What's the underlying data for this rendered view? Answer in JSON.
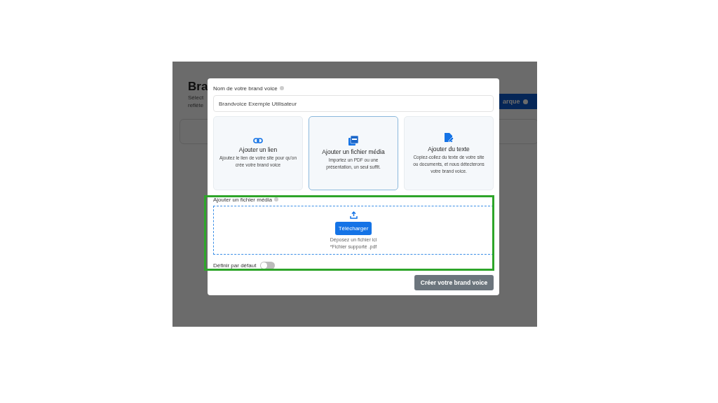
{
  "background_page": {
    "title": "Bra",
    "subtitle_lines": [
      "Sélect",
      "reflète"
    ],
    "button": "arque"
  },
  "modal": {
    "name_label": "Nom de votre brand voice",
    "name_value": "Brandvoice Exemple Utilisateur",
    "sources": [
      {
        "kind": "link",
        "title": "Ajouter un lien",
        "description": "Ajoutez le lien de votre site pour qu'on crée votre brand voice",
        "selected": false
      },
      {
        "kind": "file",
        "title": "Ajouter un fichier média",
        "description": "Importez un PDF ou une présentation, un seul suffit.",
        "selected": true
      },
      {
        "kind": "text",
        "title": "Ajouter du texte",
        "description": "Copiez-collez du texte de votre site ou documents, et nous détecterons votre brand voice.",
        "selected": false
      }
    ],
    "upload": {
      "label": "Ajouter un fichier média",
      "button": "Télécharger",
      "hint": "Déposez un fichier ici",
      "note": "*Fichier supporté .pdf"
    },
    "default_toggle": {
      "label": "Définir par défaut",
      "on": false
    },
    "submit": "Créer votre brand voice"
  }
}
